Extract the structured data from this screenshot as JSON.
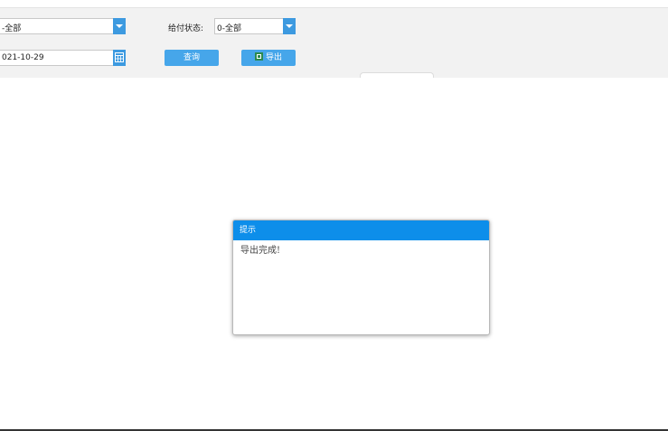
{
  "filters": {
    "select1_value": "-全部",
    "date_value": "021-10-29",
    "payment_status_label": "给付状态:",
    "payment_status_value": "0-全部"
  },
  "buttons": {
    "query_label": "查询",
    "export_label": "导出"
  },
  "dialog": {
    "title": "提示",
    "message": "导出完成!"
  },
  "colors": {
    "accent": "#46a6ea",
    "dialog_header": "#0d8eea",
    "panel_bg": "#f2f2f2"
  }
}
